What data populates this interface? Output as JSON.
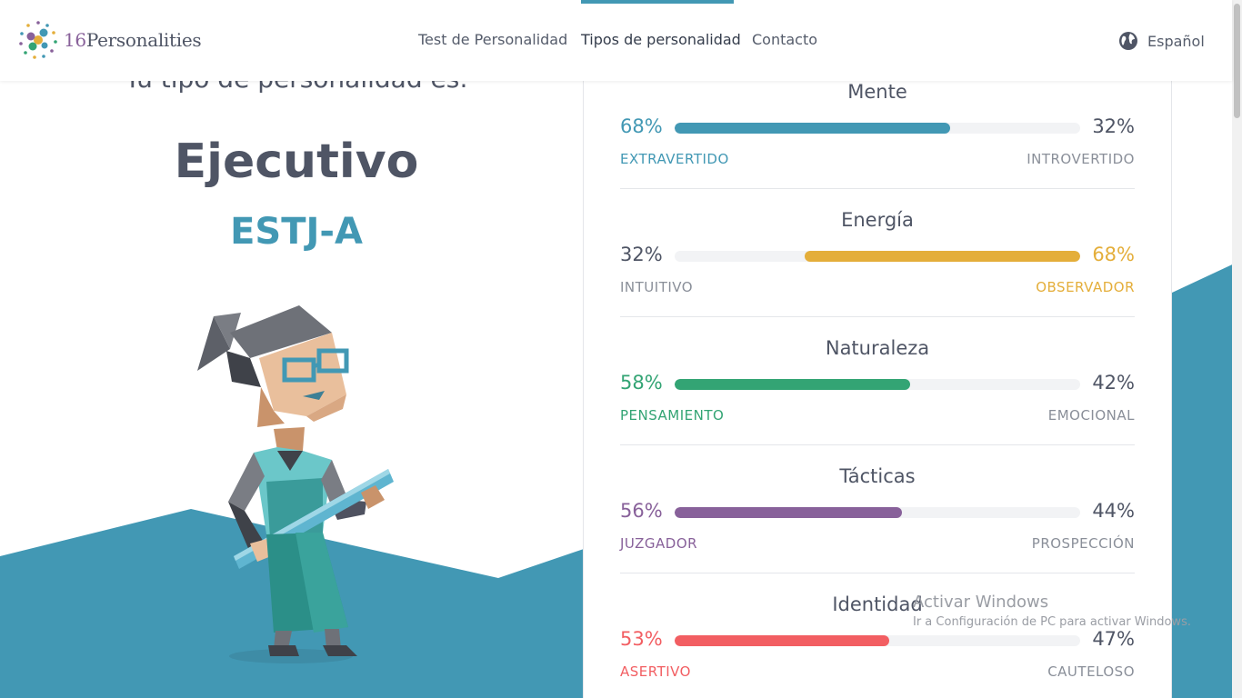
{
  "brand": {
    "number": "16",
    "name": "Personalities"
  },
  "nav": {
    "items": [
      {
        "label": "Test de Personalidad"
      },
      {
        "label": "Tipos de personalidad"
      },
      {
        "label": "Contacto"
      }
    ],
    "active_index": 1,
    "language": "Español"
  },
  "result": {
    "intro": "Tu tipo de personalidad es:",
    "type_name": "Ejecutivo",
    "type_code": "ESTJ-A"
  },
  "traits": [
    {
      "title": "Mente",
      "left_pct": "68%",
      "right_pct": "32%",
      "left_label": "EXTRAVERTIDO",
      "right_label": "INTROVERTIDO",
      "dominant": "left",
      "value": 68,
      "color": "#4298b4"
    },
    {
      "title": "Energía",
      "left_pct": "32%",
      "right_pct": "68%",
      "left_label": "INTUITIVO",
      "right_label": "OBSERVADOR",
      "dominant": "right",
      "value": 68,
      "color": "#e4ae3a"
    },
    {
      "title": "Naturaleza",
      "left_pct": "58%",
      "right_pct": "42%",
      "left_label": "PENSAMIENTO",
      "right_label": "EMOCIONAL",
      "dominant": "left",
      "value": 58,
      "color": "#33a474"
    },
    {
      "title": "Tácticas",
      "left_pct": "56%",
      "right_pct": "44%",
      "left_label": "JUZGADOR",
      "right_label": "PROSPECCIÓN",
      "dominant": "left",
      "value": 56,
      "color": "#88619a"
    },
    {
      "title": "Identidad",
      "left_pct": "53%",
      "right_pct": "47%",
      "left_label": "ASERTIVO",
      "right_label": "CAUTELOSO",
      "dominant": "left",
      "value": 53,
      "color": "#f25e62"
    }
  ],
  "colors": {
    "accent": "#4298b4",
    "text": "#4f5565",
    "muted": "#8a8f99"
  },
  "watermark": {
    "title": "Activar Windows",
    "subtitle": "Ir a Configuración de PC para activar Windows."
  }
}
